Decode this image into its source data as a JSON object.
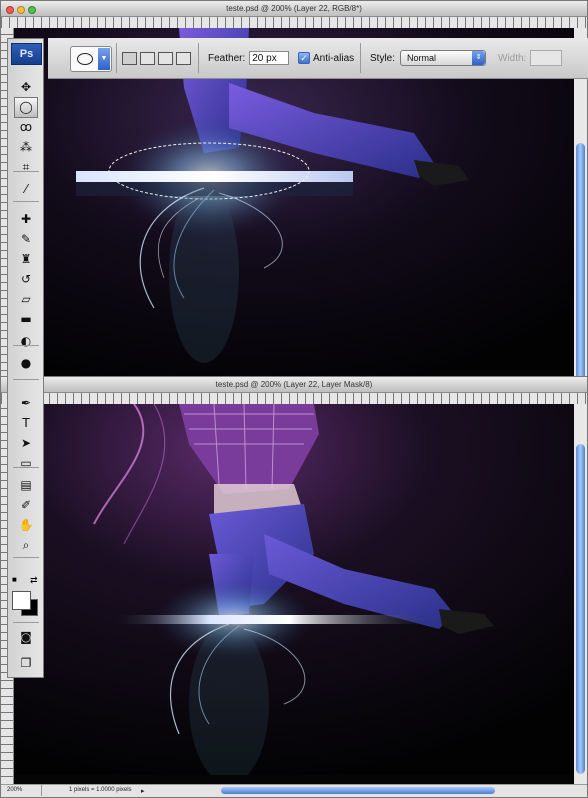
{
  "window_top": {
    "title": "teste.psd @ 200% (Layer 22, RGB/8*)"
  },
  "window_bottom": {
    "title": "teste.psd @ 200% (Layer 22, Layer Mask/8)"
  },
  "toolbox": {
    "logo": "Ps",
    "tools": [
      {
        "name": "move-tool",
        "glyph": "✥"
      },
      {
        "name": "elliptical-marquee-tool",
        "glyph": "◯"
      },
      {
        "name": "lasso-tool",
        "glyph": "ꝏ"
      },
      {
        "name": "magic-wand-tool",
        "glyph": "⁂"
      },
      {
        "name": "crop-tool",
        "glyph": "⌗"
      },
      {
        "name": "eyedropper-tool",
        "glyph": "⁄"
      },
      {
        "name": "spot-healing-tool",
        "glyph": "✚"
      },
      {
        "name": "brush-tool",
        "glyph": "✎"
      },
      {
        "name": "clone-stamp-tool",
        "glyph": "♜"
      },
      {
        "name": "history-brush-tool",
        "glyph": "↺"
      },
      {
        "name": "eraser-tool",
        "glyph": "▱"
      },
      {
        "name": "gradient-tool",
        "glyph": "▬"
      },
      {
        "name": "blur-tool",
        "glyph": "◐"
      },
      {
        "name": "dodge-tool",
        "glyph": "●"
      },
      {
        "name": "pen-tool",
        "glyph": "✒"
      },
      {
        "name": "type-tool",
        "glyph": "T"
      },
      {
        "name": "path-selection-tool",
        "glyph": "➤"
      },
      {
        "name": "rectangle-tool",
        "glyph": "▭"
      },
      {
        "name": "notes-tool",
        "glyph": "▤"
      },
      {
        "name": "eyedropper-tool-2",
        "glyph": "✐"
      },
      {
        "name": "hand-tool",
        "glyph": "✋"
      },
      {
        "name": "zoom-tool",
        "glyph": "⌕"
      },
      {
        "name": "quick-mask-tool",
        "glyph": "◙"
      },
      {
        "name": "screen-mode-tool",
        "glyph": "❐"
      }
    ]
  },
  "options_bar": {
    "feather_label": "Feather:",
    "feather_value": "20 px",
    "anti_alias_label": "Anti-alias",
    "anti_alias_checked": true,
    "style_label": "Style:",
    "style_value": "Normal",
    "width_label": "Width:"
  },
  "status_bar": {
    "zoom": "200%",
    "info": "1 pixels = 1.0000 pixels"
  },
  "colors": {
    "accent": "#3b6fd1",
    "glow": "#cfe8ff",
    "jeans": "#3b3fa0",
    "purple": "#8a3fd0"
  }
}
